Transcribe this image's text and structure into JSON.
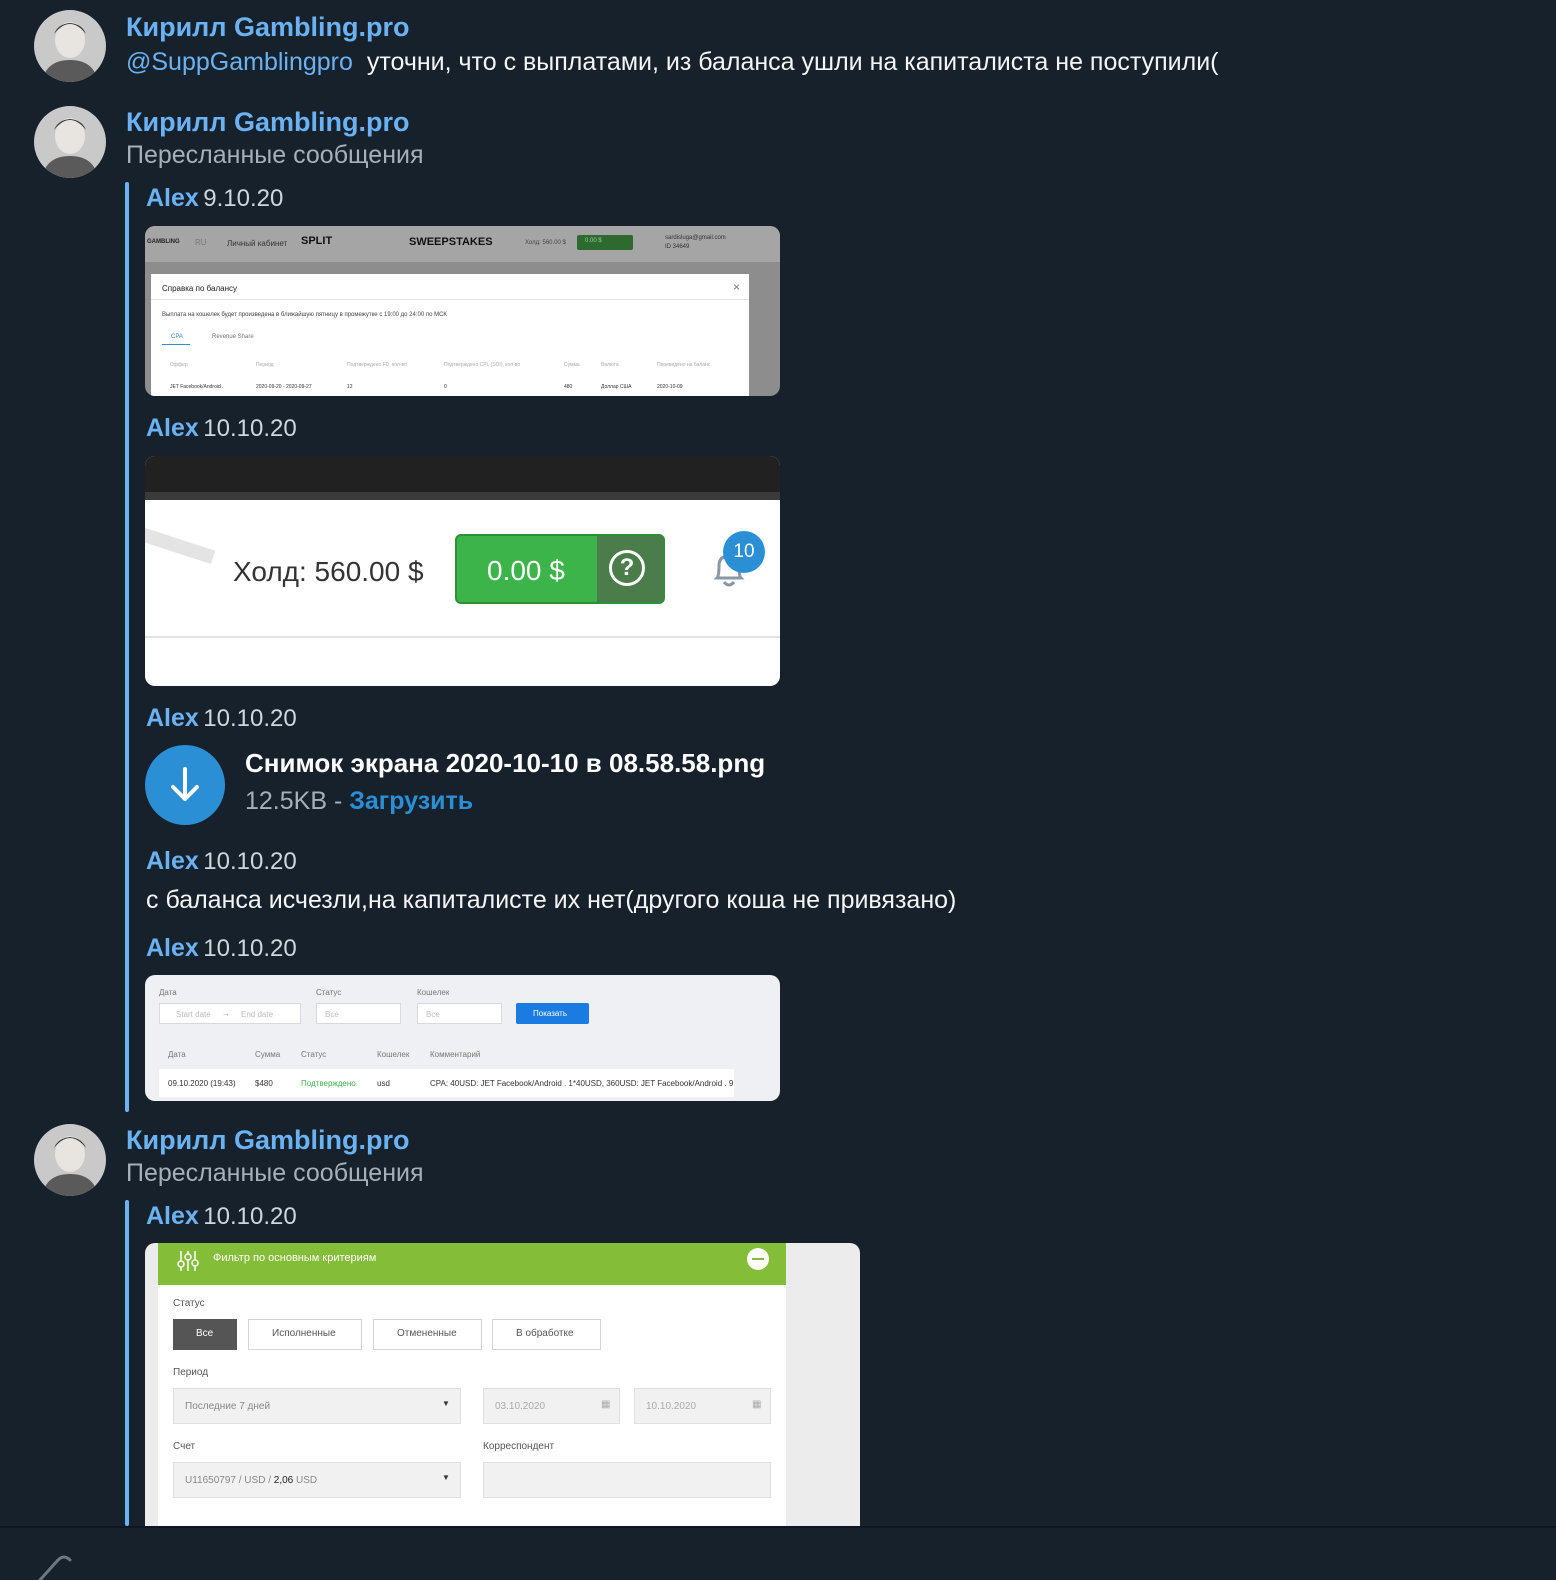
{
  "messages": [
    {
      "author": "Кирилл Gambling.pro",
      "mention": "@SuppGamblingpro",
      "text": "уточни, что с выплатами, из баланса ушли на капиталиста не поступили("
    },
    {
      "author": "Кирилл Gambling.pro",
      "subtitle": "Пересланные сообщения"
    },
    {
      "author": "Кирилл Gambling.pro",
      "subtitle": "Пересланные сообщения"
    }
  ],
  "forwarded": [
    {
      "name": "Alex",
      "date": "9.10.20"
    },
    {
      "name": "Alex",
      "date": "10.10.20"
    },
    {
      "name": "Alex",
      "date": "10.10.20"
    },
    {
      "name": "Alex",
      "date": "10.10.20",
      "text": "с баланса исчезли,на капиталисте их нет(другого коша не привязано)"
    },
    {
      "name": "Alex",
      "date": "10.10.20"
    },
    {
      "name": "Alex",
      "date": "10.10.20"
    }
  ],
  "file": {
    "name": "Снимок экрана 2020-10-10 в 08.58.58.png",
    "size": "12.5KB",
    "sep": " - ",
    "action": "Загрузить"
  },
  "shot1": {
    "logo": "GAMBLING",
    "lang": "RU",
    "cabinet": "Личный кабинет",
    "split": "SPLIT",
    "sweep": "SWEEPSTAKES",
    "hold": "Холд: 560.00 $",
    "balance": "0.00 $",
    "email": "sardisluga@gmail.com",
    "id": "ID 34649",
    "modal_title": "Справка по балансу",
    "close": "×",
    "note": "Выплата на кошелек будет произведена в ближайшую пятницу в промежутке с 19:00 до 24:00 по МСК",
    "tabs": [
      "CPA",
      "Revenue Share"
    ],
    "headers": [
      "Оффер",
      "Период",
      "Подтверждено FD, кол-во",
      "Подтверждено CPL (SOI), кол-во",
      "Сумма",
      "Валюта",
      "Переведено на баланс"
    ],
    "row": [
      "JET Facebook/Android .",
      "2020-09-20 - 2020-09-27",
      "12",
      "0",
      "480",
      "Доллар США",
      "2020-10-09"
    ]
  },
  "shot2": {
    "hold": "Холд: 560.00 $",
    "balance": "0.00 $",
    "help": "?",
    "badge": "10"
  },
  "shot3": {
    "labels": [
      "Дата",
      "Статус",
      "Кошелек"
    ],
    "start": "Start date",
    "arrow": "→",
    "end": "End date",
    "all": "Все",
    "show": "Показать",
    "headers": [
      "Дата",
      "Сумма",
      "Статус",
      "Кошелек",
      "Комментарий"
    ],
    "row": [
      "09.10.2020 (19:43)",
      "$480",
      "Подтверждено",
      "usd",
      "CPA: 40USD: JET Facebook/Android . 1*40USD, 360USD: JET Facebook/Android . 9"
    ]
  },
  "shot4": {
    "title": "Фильтр по основным критериям",
    "status_label": "Статус",
    "buttons": [
      "Все",
      "Исполненные",
      "Отмененные",
      "В обработке"
    ],
    "period_label": "Период",
    "period": "Последние 7 дней",
    "from": "03.10.2020",
    "to": "10.10.2020",
    "account_label": "Счет",
    "account": "U11650797 / USD / ",
    "account_amount": "2,06",
    "account_cur": " USD",
    "corr_label": "Корреспондент"
  },
  "colors": {
    "bg": "#17212b",
    "accent": "#6ab2f2",
    "green": "#3cb44a",
    "lime": "#84bd38",
    "download": "#2b8fd6"
  }
}
